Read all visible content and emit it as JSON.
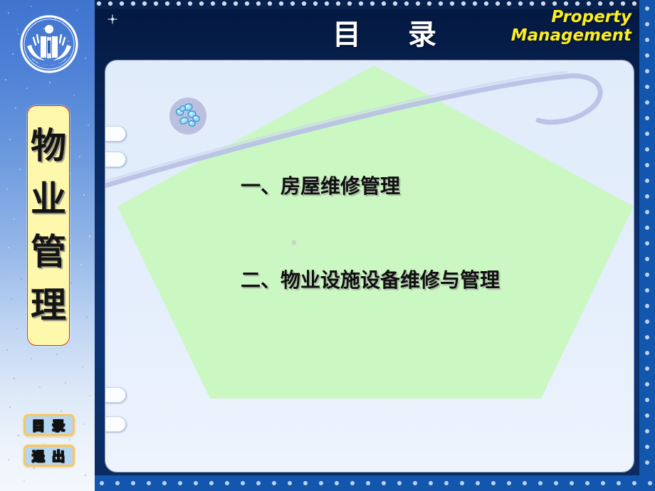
{
  "slide": {
    "title": "目    录",
    "brand_line1": "Property",
    "brand_line2": "Management",
    "logo_name": "university-emblem"
  },
  "sidebar": {
    "vertical_title_chars": [
      "物",
      "业",
      "管",
      "理"
    ],
    "vertical_title_text": "物业管理",
    "buttons": [
      {
        "id": "contents",
        "label": "目 录",
        "name": "nav-button-contents"
      },
      {
        "id": "exit",
        "label": "退 出",
        "name": "nav-button-exit"
      }
    ]
  },
  "content": {
    "items": [
      "一、房屋维修管理",
      "二、物业设施设备维修与管理"
    ]
  },
  "decorations": {
    "molecule_icon": "molecule-cluster-icon",
    "swoosh": "swoosh-curve",
    "sparkle_icon": "sparkle-icon",
    "ring_count": 4,
    "pentagon": "pentagon-shape"
  },
  "colors": {
    "panel_dark_blue": "#0b2f6b",
    "header_yellow": "#fcee21",
    "pentagon_green": "#caf7c2",
    "card_blue": "#e1ecfb",
    "sidebar_blue": "#3f74cf",
    "vertical_card_yellow": "#fdf8ab",
    "vertical_card_border_red": "#e02a18",
    "button_fill": "#b4d7f2",
    "button_border": "#f9c565",
    "band_blue": "#1a61c2"
  }
}
